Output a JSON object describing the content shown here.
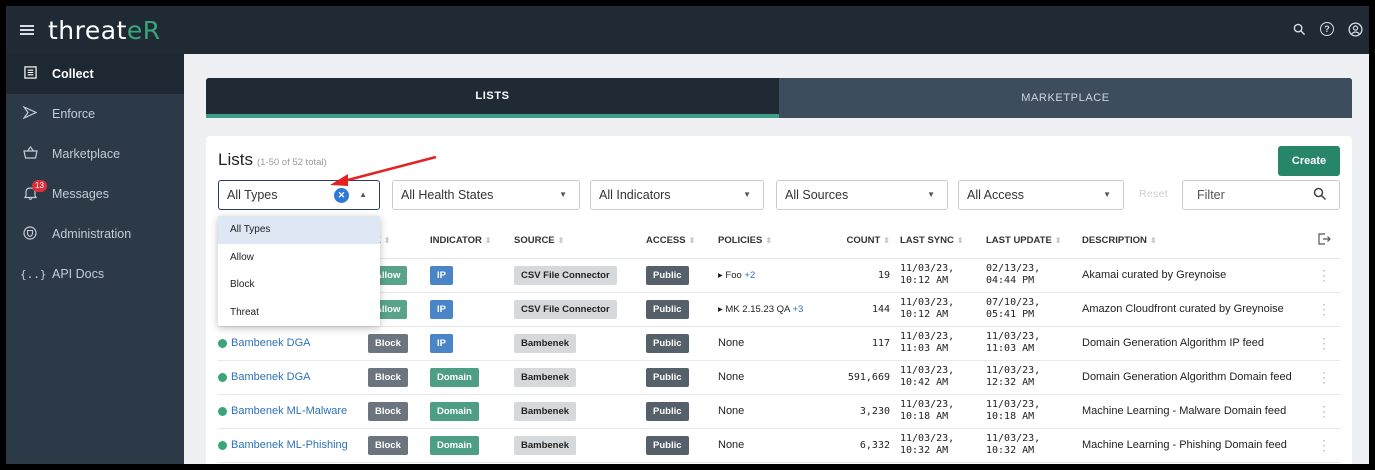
{
  "app": {
    "logo_main": "threat",
    "logo_accent": "eR"
  },
  "topbar": {
    "icons": [
      "search-icon",
      "help-icon",
      "account-icon"
    ]
  },
  "sidebar": {
    "items": [
      {
        "label": "Collect",
        "icon": "collect-icon",
        "active": true
      },
      {
        "label": "Enforce",
        "icon": "enforce-icon"
      },
      {
        "label": "Marketplace",
        "icon": "basket-icon"
      },
      {
        "label": "Messages",
        "icon": "bell-icon",
        "badge": "13"
      },
      {
        "label": "Administration",
        "icon": "shield-icon"
      },
      {
        "label": "API Docs",
        "icon": "braces-icon"
      }
    ]
  },
  "tabs": {
    "lists": "LISTS",
    "marketplace": "MARKETPLACE"
  },
  "card": {
    "title": "Lists",
    "subtitle": "(1-50 of 52 total)",
    "create_label": "Create"
  },
  "filters": {
    "type": "All Types",
    "health": "All Health States",
    "indicator": "All Indicators",
    "source": "All Sources",
    "access": "All Access",
    "reset": "Reset",
    "filter_placeholder": "Filter"
  },
  "dropdown": {
    "options": [
      "All Types",
      "Allow",
      "Block",
      "Threat"
    ],
    "selected": "All Types"
  },
  "table": {
    "headers": {
      "type": "PE",
      "indicator": "INDICATOR",
      "source": "SOURCE",
      "access": "ACCESS",
      "policies": "POLICIES",
      "count": "COUNT",
      "last_sync": "LAST SYNC",
      "last_update": "LAST UPDATE",
      "description": "DESCRIPTION"
    },
    "rows": [
      {
        "name": "",
        "type": "Allow",
        "indicator": "IP",
        "source": "CSV File Connector",
        "access": "Public",
        "policy": "▸ Foo",
        "policy_extra": "+2",
        "count": "19",
        "sync1": "11/03/23,",
        "sync2": "10:12 AM",
        "upd1": "02/13/23,",
        "upd2": "04:44 PM",
        "description": "Akamai curated by Greynoise"
      },
      {
        "name": "",
        "type": "Allow",
        "indicator": "IP",
        "source": "CSV File Connector",
        "access": "Public",
        "policy": "▸ MK 2.15.23 QA",
        "policy_extra": "+3",
        "count": "144",
        "sync1": "11/03/23,",
        "sync2": "10:12 AM",
        "upd1": "07/10/23,",
        "upd2": "05:41 PM",
        "description": "Amazon Cloudfront curated by Greynoise"
      },
      {
        "name": "Bambenek DGA",
        "type": "Block",
        "indicator": "IP",
        "source": "Bambenek",
        "access": "Public",
        "policy": "None",
        "policy_extra": "",
        "count": "117",
        "sync1": "11/03/23,",
        "sync2": "11:03 AM",
        "upd1": "11/03/23,",
        "upd2": "11:03 AM",
        "description": "Domain Generation Algorithm IP feed"
      },
      {
        "name": "Bambenek DGA",
        "type": "Block",
        "indicator": "Domain",
        "source": "Bambenek",
        "access": "Public",
        "policy": "None",
        "policy_extra": "",
        "count": "591,669",
        "sync1": "11/03/23,",
        "sync2": "10:42 AM",
        "upd1": "11/03/23,",
        "upd2": "12:32 AM",
        "description": "Domain Generation Algorithm Domain feed"
      },
      {
        "name": "Bambenek ML-Malware",
        "type": "Block",
        "indicator": "Domain",
        "source": "Bambenek",
        "access": "Public",
        "policy": "None",
        "policy_extra": "",
        "count": "3,230",
        "sync1": "11/03/23,",
        "sync2": "10:18 AM",
        "upd1": "11/03/23,",
        "upd2": "10:18 AM",
        "description": "Machine Learning - Malware Domain feed"
      },
      {
        "name": "Bambenek ML-Phishing",
        "type": "Block",
        "indicator": "Domain",
        "source": "Bambenek",
        "access": "Public",
        "policy": "None",
        "policy_extra": "",
        "count": "6,332",
        "sync1": "11/03/23,",
        "sync2": "10:32 AM",
        "upd1": "11/03/23,",
        "upd2": "10:32 AM",
        "description": "Machine Learning - Phishing Domain feed"
      }
    ]
  },
  "colors": {
    "brand_green": "#27856a",
    "topbar": "#1f2a35",
    "sidebar": "#2c3a48",
    "link": "#2d72b8",
    "arrow": "#e32222"
  }
}
